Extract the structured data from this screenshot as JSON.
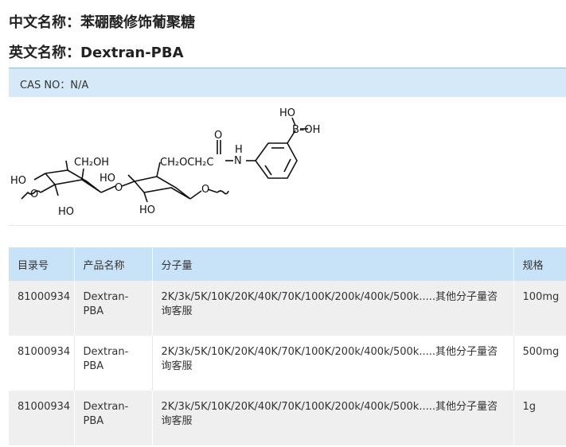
{
  "header": {
    "cn_label": "中文名称：",
    "cn_value": "苯硼酸修饰葡聚糖",
    "en_label": "英文名称：",
    "en_value": "Dextran-PBA"
  },
  "cas": {
    "text": "CAS NO：N/A"
  },
  "structure": {
    "labels": {
      "ho_top": "HO",
      "b_oh": "B–OH",
      "o_carbonyl": "O",
      "n": "N",
      "h": "H",
      "ch2oh": "CH₂OH",
      "ch2och2c": "CH₂OCH₂C",
      "ho_left": "HO",
      "ho_mid": "HO",
      "o_left": "O",
      "o_bridge": "O",
      "o_right": "O",
      "ho_bottom1": "HO",
      "ho_bottom2": "HO"
    }
  },
  "table": {
    "headers": [
      "目录号",
      "产品名称",
      "分子量",
      "规格"
    ],
    "rows": [
      [
        "81000934",
        "Dextran-PBA",
        "2K/3k/5K/10K/20K/40K/70K/100K/200k/400k/500k.....其他分子量咨询客服",
        "100mg"
      ],
      [
        "81000934",
        "Dextran-PBA",
        "2K/3k/5K/10K/20K/40K/70K/100K/200k/400k/500k.....其他分子量咨询客服",
        "500mg"
      ],
      [
        "81000934",
        "Dextran-PBA",
        "2K/3k/5K/10K/20K/40K/70K/100K/200k/400k/500k.....其他分子量咨询客服",
        "1g"
      ]
    ]
  }
}
